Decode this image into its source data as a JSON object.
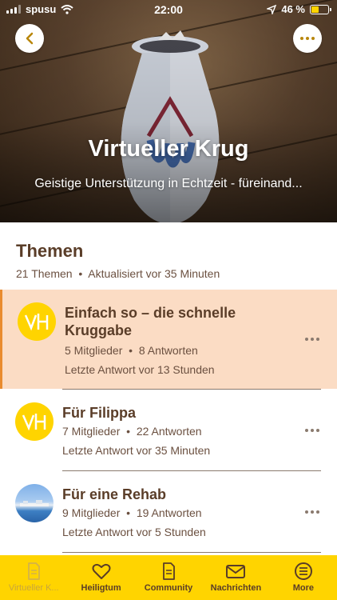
{
  "status_bar": {
    "carrier": "spusu",
    "time": "22:00",
    "battery_percent": "46 %",
    "battery_level": 0.46
  },
  "header": {
    "title": "Virtueller Krug",
    "subtitle": "Geistige Unterstützung in Echtzeit - füreinand...",
    "back_icon": "chevron-left-icon",
    "more_icon": "ellipsis-icon"
  },
  "section": {
    "title": "Themen",
    "count": "21 Themen",
    "separator": "•",
    "updated": "Aktualisiert vor 35 Minuten"
  },
  "topics": [
    {
      "title_line1": "Einfach so – die schnelle",
      "title_line2": "Kruggabe",
      "members": "5 Mitglieder",
      "sep": "•",
      "replies": "8 Antworten",
      "last_reply": "Letzte Antwort vor 13 Stunden",
      "avatar_text": "vH",
      "active": true
    },
    {
      "title_line1": "Für Filippa",
      "members": "7 Mitglieder",
      "sep": "•",
      "replies": "22 Antworten",
      "last_reply": "Letzte Antwort vor 35 Minuten",
      "avatar_text": "vH",
      "active": false
    },
    {
      "title_line1": "Für eine Rehab",
      "members": "9 Mitglieder",
      "sep": "•",
      "replies": "19 Antworten",
      "last_reply": "Letzte Antwort vor 5 Stunden",
      "avatar_text": "",
      "active": false
    }
  ],
  "tabbar": [
    {
      "label": "Virtueller K...",
      "icon": "document-icon"
    },
    {
      "label": "Heiligtum",
      "icon": "heart-icon"
    },
    {
      "label": "Community",
      "icon": "file-text-icon"
    },
    {
      "label": "Nachrichten",
      "icon": "mail-icon"
    },
    {
      "label": "More",
      "icon": "list-circle-icon"
    }
  ],
  "colors": {
    "accent_yellow": "#ffd400",
    "brown_text": "#5a3d28",
    "active_row_bg": "#fbdcc4",
    "active_row_border": "#e98b2e"
  }
}
